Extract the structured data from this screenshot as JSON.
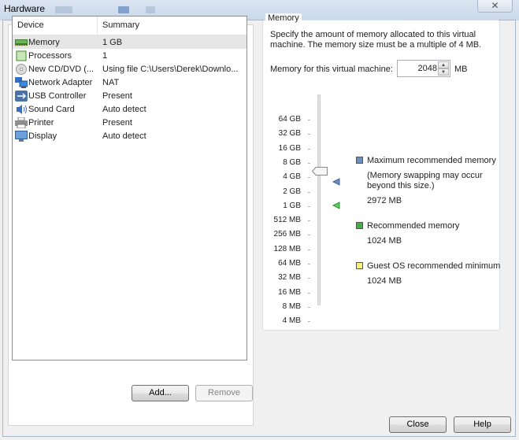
{
  "window": {
    "title": "Hardware",
    "close_glyph": "✕"
  },
  "device_list": {
    "columns": [
      "Device",
      "Summary"
    ],
    "rows": [
      {
        "icon": "memory-icon",
        "device": "Memory",
        "summary": "1 GB",
        "selected": true
      },
      {
        "icon": "processor-icon",
        "device": "Processors",
        "summary": "1"
      },
      {
        "icon": "cd-dvd-icon",
        "device": "New CD/DVD (...",
        "summary": "Using file C:\\Users\\Derek\\Downlo..."
      },
      {
        "icon": "network-adapter-icon",
        "device": "Network Adapter",
        "summary": "NAT"
      },
      {
        "icon": "usb-icon",
        "device": "USB Controller",
        "summary": "Present"
      },
      {
        "icon": "sound-card-icon",
        "device": "Sound Card",
        "summary": "Auto detect"
      },
      {
        "icon": "printer-icon",
        "device": "Printer",
        "summary": "Present"
      },
      {
        "icon": "display-icon",
        "device": "Display",
        "summary": "Auto detect"
      }
    ],
    "add_label": "Add...",
    "remove_label": "Remove"
  },
  "memory": {
    "group_title": "Memory",
    "description": "Specify the amount of memory allocated to this virtual machine. The memory size must be a multiple of 4 MB.",
    "field_label": "Memory for this virtual machine:",
    "value": "2048",
    "unit": "MB",
    "scale_labels": [
      "64 GB",
      "32 GB",
      "16 GB",
      "8 GB",
      "4 GB",
      "2 GB",
      "1 GB",
      "512 MB",
      "256 MB",
      "128 MB",
      "64 MB",
      "32 MB",
      "16 MB",
      "8 MB",
      "4 MB"
    ],
    "slider_value": "2 GB",
    "legend": [
      {
        "label": "Maximum recommended memory",
        "note": "(Memory swapping may occur beyond this size.)",
        "value": "2972 MB",
        "color": "#6b8fc1"
      },
      {
        "label": "Recommended memory",
        "value": "1024 MB",
        "color": "#3cb43c"
      },
      {
        "label": "Guest OS recommended minimum",
        "value": "1024 MB",
        "color": "#f5f07a"
      }
    ]
  },
  "footer": {
    "close_label": "Close",
    "help_label": "Help"
  }
}
